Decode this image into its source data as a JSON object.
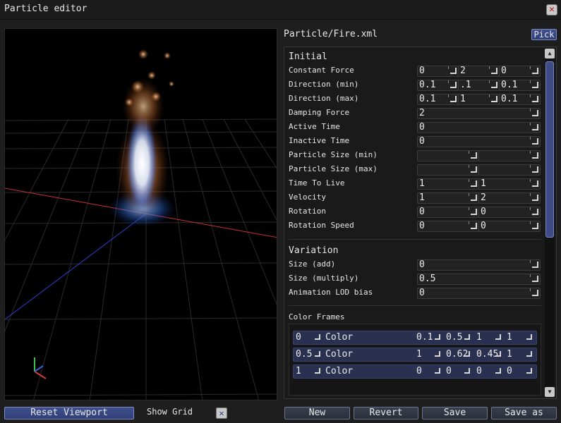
{
  "window": {
    "title": "Particle editor"
  },
  "viewport": {
    "reset_label": "Reset Viewport",
    "show_grid_label": "Show Grid",
    "show_grid_checked": true
  },
  "file": {
    "path": "Particle/Fire.xml",
    "pick_label": "Pick"
  },
  "sections": {
    "initial_title": "Initial",
    "variation_title": "Variation",
    "color_frames_title": "Color Frames"
  },
  "initial": {
    "constant_force": {
      "label": "Constant Force",
      "values": [
        "0",
        "2",
        "0"
      ]
    },
    "direction_min": {
      "label": "Direction (min)",
      "values": [
        "0.1",
        ".1",
        "0.1"
      ]
    },
    "direction_max": {
      "label": "Direction (max)",
      "values": [
        "0.1",
        "1",
        "0.1"
      ]
    },
    "damping_force": {
      "label": "Damping Force",
      "value": "2"
    },
    "active_time": {
      "label": "Active Time",
      "value": "0"
    },
    "inactive_time": {
      "label": "Inactive Time",
      "value": "0"
    },
    "particle_size_min": {
      "label": "Particle Size (min)",
      "values": [
        "",
        ""
      ]
    },
    "particle_size_max": {
      "label": "Particle Size (max)",
      "values": [
        "",
        ""
      ]
    },
    "time_to_live": {
      "label": "Time To Live",
      "values": [
        "1",
        "1"
      ]
    },
    "velocity": {
      "label": "Velocity",
      "values": [
        "1",
        "2"
      ]
    },
    "rotation": {
      "label": "Rotation",
      "values": [
        "0",
        "0"
      ]
    },
    "rotation_speed": {
      "label": "Rotation Speed",
      "values": [
        "0",
        "0"
      ]
    }
  },
  "variation": {
    "size_add": {
      "label": "Size (add)",
      "value": "0"
    },
    "size_multiply": {
      "label": "Size (multiply)",
      "value": "0.5"
    },
    "animation_lod_bias": {
      "label": "Animation LOD bias",
      "value": "0"
    }
  },
  "color_frames": [
    {
      "time": "0",
      "type": "Color",
      "rgba": [
        "0.1",
        "0.5",
        "1",
        "1"
      ]
    },
    {
      "time": "0.5",
      "type": "Color",
      "rgba": [
        "1",
        "0.62",
        "0.45",
        "1"
      ]
    },
    {
      "time": "1",
      "type": "Color",
      "rgba": [
        "0",
        "0",
        "0",
        "0"
      ]
    }
  ],
  "bottom_buttons": {
    "new": "New",
    "revert": "Revert",
    "save": "Save",
    "save_as": "Save as"
  },
  "colors": {
    "accent": "#3d4b88",
    "x_axis": "#d43a3a",
    "y_axis": "#3ac14a",
    "z_axis": "#3a5cd4"
  }
}
